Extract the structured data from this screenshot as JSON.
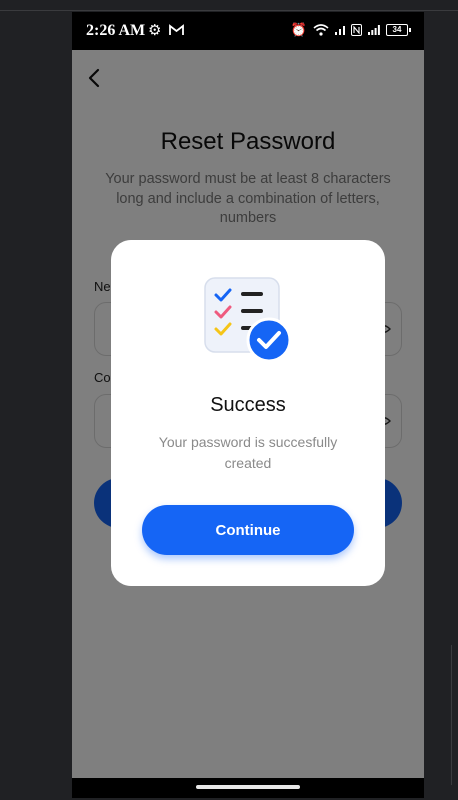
{
  "status_bar": {
    "time": "2:26 AM",
    "battery": "34",
    "icons": [
      "gear-icon",
      "gmail-icon",
      "alarm-icon",
      "wifi-icon",
      "nfc-icon",
      "signal-icon",
      "battery-icon"
    ]
  },
  "reset_screen": {
    "title": "Reset Password",
    "subtitle": "Your password must be at least 8 characters long and include a combination of letters, numbers",
    "new_password_label": "Ne",
    "confirm_password_label": "Co"
  },
  "dialog": {
    "title": "Success",
    "message": "Your password is succesfully created",
    "button_label": "Continue"
  },
  "colors": {
    "accent": "#1565f5",
    "overlay": "rgba(0,0,0,0.5)",
    "check_blue": "#1565f5",
    "check_pink": "#ef5b7f",
    "check_yellow": "#f5c518"
  }
}
